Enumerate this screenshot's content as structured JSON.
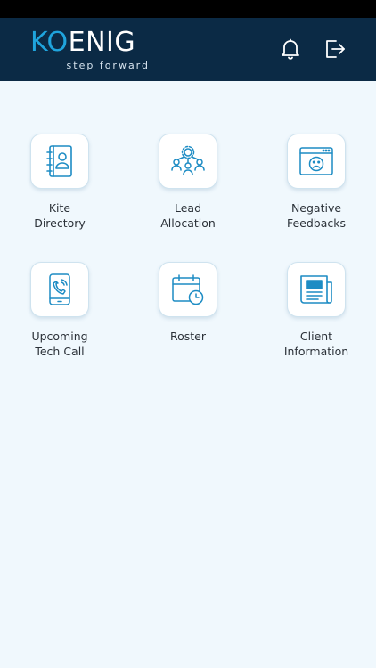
{
  "header": {
    "logo_main": "KOENIG",
    "logo_tagline": "step forward",
    "colors": {
      "bar": "#0b2a45",
      "accent": "#1fa4dd"
    }
  },
  "tiles": [
    {
      "label": "Kite\nDirectory",
      "icon": "contact-book-icon"
    },
    {
      "label": "Lead\nAllocation",
      "icon": "team-network-icon"
    },
    {
      "label": "Negative\nFeedbacks",
      "icon": "sad-face-window-icon"
    },
    {
      "label": "Upcoming\nTech Call",
      "icon": "phone-tablet-icon"
    },
    {
      "label": "Roster",
      "icon": "calendar-clock-icon"
    },
    {
      "label": "Client\nInformation",
      "icon": "newspaper-icon"
    }
  ]
}
